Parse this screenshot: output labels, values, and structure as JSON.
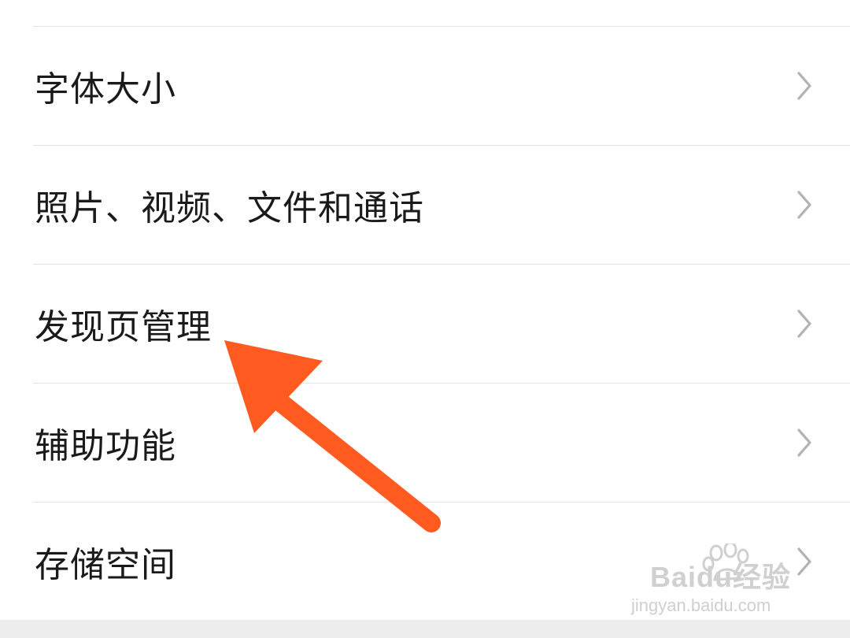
{
  "settings": {
    "items": [
      {
        "label": "字体大小"
      },
      {
        "label": "照片、视频、文件和通话"
      },
      {
        "label": "发现页管理"
      },
      {
        "label": "辅助功能"
      },
      {
        "label": "存储空间"
      }
    ]
  },
  "icons": {
    "row_chevron": "chevron-right-icon",
    "annotation": "arrow-icon"
  },
  "colors": {
    "annotation_arrow": "#ff5a1f",
    "divider": "#e3e3e3",
    "chevron": "#b2b2b2",
    "text": "#1a1a1a"
  },
  "watermark": {
    "logo_text": "Baidu经验",
    "url": "jingyan.baidu.com"
  }
}
